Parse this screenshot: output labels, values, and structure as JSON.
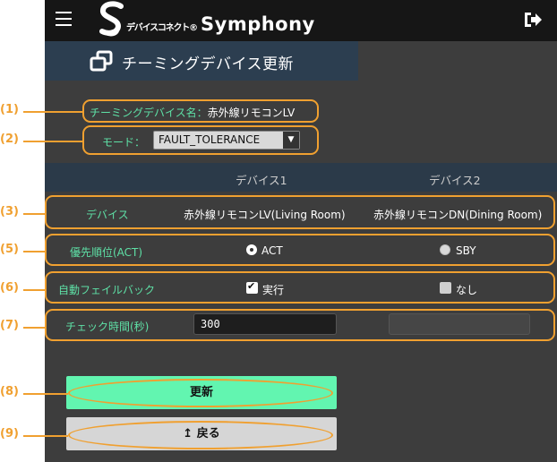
{
  "header": {
    "logo_letter": "S",
    "logo_small": "デバイスコネクト®",
    "logo_big": "Symphony",
    "menu_icon": "hamburger-menu-icon",
    "logout_icon": "logout-icon"
  },
  "page": {
    "title": "チーミングデバイス更新",
    "title_icon": "window-restore-icon"
  },
  "form": {
    "device_name_label": "チーミングデバイス名：",
    "device_name_value": "赤外線リモコンLV",
    "mode_label": "モード：",
    "mode_value": "FAULT_TOLERANCE"
  },
  "table": {
    "columns": [
      "デバイス1",
      "デバイス2"
    ],
    "rows": {
      "device": {
        "label": "デバイス",
        "values": [
          "赤外線リモコンLV(Living Room)",
          "赤外線リモコンDN(Dining Room)"
        ]
      },
      "priority": {
        "label": "優先順位(ACT)",
        "values": [
          "ACT",
          "SBY"
        ],
        "selected": "ACT"
      },
      "failback": {
        "label": "自動フェイルバック",
        "values": [
          "実行",
          "なし"
        ],
        "checked": [
          true,
          false
        ]
      },
      "check_time": {
        "label": "チェック時間(秒)",
        "value": "300",
        "value2": ""
      }
    }
  },
  "buttons": {
    "update": "更新",
    "back_icon": "↥",
    "back": "戻る"
  },
  "annotations": [
    "(1)",
    "(2)",
    "(3)",
    "(5)",
    "(6)",
    "(7)",
    "(8)",
    "(9)"
  ],
  "colors": {
    "accent_green": "#62f5b0",
    "label_green": "#5ee0a6",
    "annotation_orange": "#f0a030",
    "topbar": "#161616",
    "panel": "#3d3d3d",
    "title_band": "#2c3e50"
  }
}
